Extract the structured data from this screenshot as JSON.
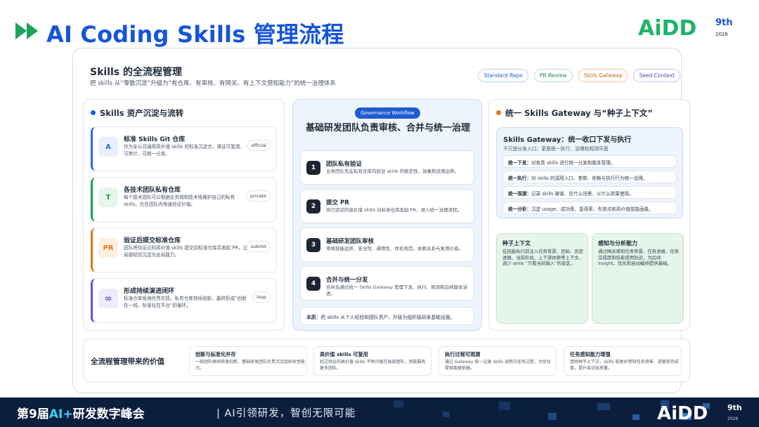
{
  "header": {
    "title": "AI Coding Skills 管理流程",
    "logo_text": "AiDD",
    "logo_sup": "9th",
    "logo_year": "2026"
  },
  "overview": {
    "title": "Skills 的全流程管理",
    "subtitle": "把 skills 从“零散沉淀”升级为“有仓库、有审核、有网关、有上下文感知能力”的统一治理体系",
    "pills": [
      "Standard Repo",
      "PR Review",
      "Skills Gateway",
      "Seed Context"
    ]
  },
  "left": {
    "title": "Skills 资产沉淀与流转",
    "accent": "#1f5bd1",
    "items": [
      {
        "icon": "A",
        "name": "标准 Skills Git 仓库",
        "desc": "作为全公司通用高价值 skills 的标准沉淀仓，保证可复用、可审计、可统一分发。",
        "tag": "official",
        "color": "#2d6ae3",
        "bg": "#e9f0fd"
      },
      {
        "icon": "T",
        "name": "各技术团队私有仓库",
        "desc": "每个技术团队可以根据业务域和技术栈维护自己的私有 skills，先在团队内快速验证价值。",
        "tag": "private",
        "color": "#16a34a",
        "bg": "#e6f6ec"
      },
      {
        "icon": "PR",
        "name": "验证后提交标准仓库",
        "desc": "团队将验证过的高价值 skills 提交到标准仓库并发起 PR，让局部经验沉淀为全局能力。",
        "tag": "submit",
        "color": "#e07b12",
        "bg": "#fdf0e2"
      },
      {
        "icon": "∞",
        "name": "形成持续演进闭环",
        "desc": "标准仓库吸纳优秀实践，私有仓库持续创新，最终形成“创新在一线，标准化在平台”的循环。",
        "tag": "loop",
        "color": "#6d4be0",
        "bg": "#efeafd"
      }
    ]
  },
  "workflow": {
    "badge": "Governance Workflow",
    "title": "基础研发团队负责审核、合并与统一治理",
    "steps": [
      {
        "num": "1",
        "name": "团队私有验证",
        "desc": "业务团队先在私有仓库内验证 skills 的稳定性、效果和适用边界。"
      },
      {
        "num": "2",
        "name": "提交 PR",
        "desc": "将已验证的高价值 skills 向标准仓库发起 PR，进入统一治理流程。"
      },
      {
        "num": "3",
        "name": "基础研发团队审核",
        "desc": "审核技能边界、安全性、通用性、命名规范、依赖关系与复用价值。"
      },
      {
        "num": "4",
        "name": "合并与统一分发",
        "desc": "合并后通过统一 Skills Gateway 管理下发、执行、观测和后续版本演进。"
      }
    ],
    "note_label": "本质：",
    "note_text": "把 skills 从个人经验和团队资产，升级为组织级研发基础设施。"
  },
  "right": {
    "title": "统一 Skills Gateway 与“种子上下文”",
    "accent": "#e07b12",
    "gateway": {
      "title": "Skills Gateway：统一收口下发与执行",
      "subtitle": "不只是分发入口，更是统一执行、治理和观测平面",
      "rows": [
        {
          "label": "统一下发：",
          "text": "对各类 skills 进行统一分发和版本管理。"
        },
        {
          "label": "统一执行：",
          "text": "对 skills 的调用入口、参数、依赖与执行行为统一治理。"
        },
        {
          "label": "统一观测：",
          "text": "记录 skills 被谁、在什么场景、以什么效果使用。"
        },
        {
          "label": "统一分析：",
          "text": "沉淀 usage、成功率、复用率、失效点和高价值技能画像。"
        }
      ]
    },
    "seed": {
      "name": "种子上下文",
      "desc": "在技能执行前注入任务背景、目标、历史进展、当前阶段、上下游依赖等上下文，减少 skills “只看当前输入”的盲区。"
    },
    "sense": {
      "name": "感知与分析能力",
      "desc": "通过网关感知任务背景、任务进展、任务完成度和技能使用轨迹，为后续 insight、优化和自动编排提供基础。"
    }
  },
  "value": {
    "label": "全流程管理带来的价值",
    "items": [
      {
        "name": "创新与标准化并存",
        "desc": "一线团队继续快速创新，基础研发团队负责沉淀组织共性能力。"
      },
      {
        "name": "高价值 skills 可复用",
        "desc": "经过验证的高价值 skills 不再只留在局部团队，而能服务更多团队。"
      },
      {
        "name": "执行过程可观测",
        "desc": "通过 Gateway 统一记录 skills 调用与任务过程，为优化提供数据依据。"
      },
      {
        "name": "任务感知能力增强",
        "desc": "借助种子上下文，skills 能更好感知任务背景、进度和完成度，提升自动化质量。"
      }
    ]
  },
  "footer": {
    "event_prefix": "第9届",
    "event_highlight": "AI+",
    "event_suffix": "研发数字峰会",
    "slogan": "|  AI引领研发，智创无限可能",
    "logo_text": "AiDD",
    "logo_sup": "9th",
    "logo_year": "2026"
  }
}
